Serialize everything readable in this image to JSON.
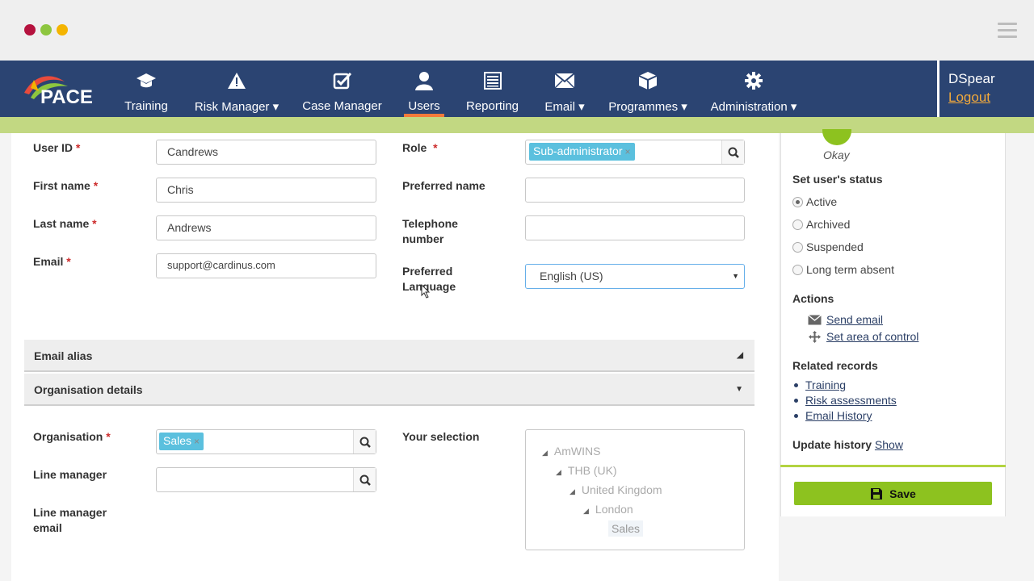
{
  "window": {
    "dot_colors": [
      "#b5123e",
      "#8dc63f",
      "#f4b400"
    ]
  },
  "app": {
    "logo_text": "PACE"
  },
  "nav": {
    "items": [
      {
        "label": "Training",
        "icon": "graduation-cap-icon"
      },
      {
        "label": "Risk Manager ▾",
        "icon": "warning-icon"
      },
      {
        "label": "Case Manager",
        "icon": "checkbox-icon"
      },
      {
        "label": "Users",
        "icon": "user-icon",
        "active": true
      },
      {
        "label": "Reporting",
        "icon": "report-list-icon"
      },
      {
        "label": "Email ▾",
        "icon": "envelope-icon"
      },
      {
        "label": "Programmes ▾",
        "icon": "cube-icon"
      },
      {
        "label": "Administration ▾",
        "icon": "gear-icon"
      }
    ],
    "user_name": "DSpear",
    "logout_label": "Logout"
  },
  "form": {
    "user_id": {
      "label": "User ID",
      "value": "Candrews"
    },
    "first_name": {
      "label": "First name",
      "value": "Chris"
    },
    "last_name": {
      "label": "Last name",
      "value": "Andrews"
    },
    "email": {
      "label": "Email",
      "value": "support@cardinus.com"
    },
    "role": {
      "label": "Role",
      "tag": "Sub-administrator"
    },
    "preferred_name": {
      "label": "Preferred name",
      "value": ""
    },
    "telephone": {
      "label_line1": "Telephone",
      "label_line2": "number",
      "value": ""
    },
    "language": {
      "label_line1": "Preferred",
      "label_line2": "Language",
      "value": "English (US)"
    },
    "required_mark": "*"
  },
  "sections": {
    "email_alias": "Email alias",
    "organisation_details": "Organisation details"
  },
  "org": {
    "organisation": {
      "label": "Organisation",
      "tag": "Sales"
    },
    "line_manager": {
      "label": "Line manager",
      "value": ""
    },
    "line_manager_email": {
      "label_line1": "Line manager",
      "label_line2": "email"
    },
    "your_selection": "Your selection",
    "tree": [
      "AmWINS",
      "THB (UK)",
      "United Kingdom",
      "London",
      "Sales"
    ]
  },
  "sidebar": {
    "status_text": "Okay",
    "status_heading": "Set user's status",
    "statuses": [
      {
        "label": "Active",
        "checked": true
      },
      {
        "label": "Archived",
        "checked": false
      },
      {
        "label": "Suspended",
        "checked": false
      },
      {
        "label": "Long term absent",
        "checked": false
      }
    ],
    "actions_heading": "Actions",
    "actions": [
      {
        "label": "Send email",
        "icon": "envelope-icon"
      },
      {
        "label": "Set area of control",
        "icon": "move-arrows-icon"
      }
    ],
    "related_heading": "Related records",
    "related": [
      "Training",
      "Risk assessments",
      "Email History"
    ],
    "update_history_label": "Update history",
    "update_history_link": "Show",
    "save_label": "Save"
  }
}
